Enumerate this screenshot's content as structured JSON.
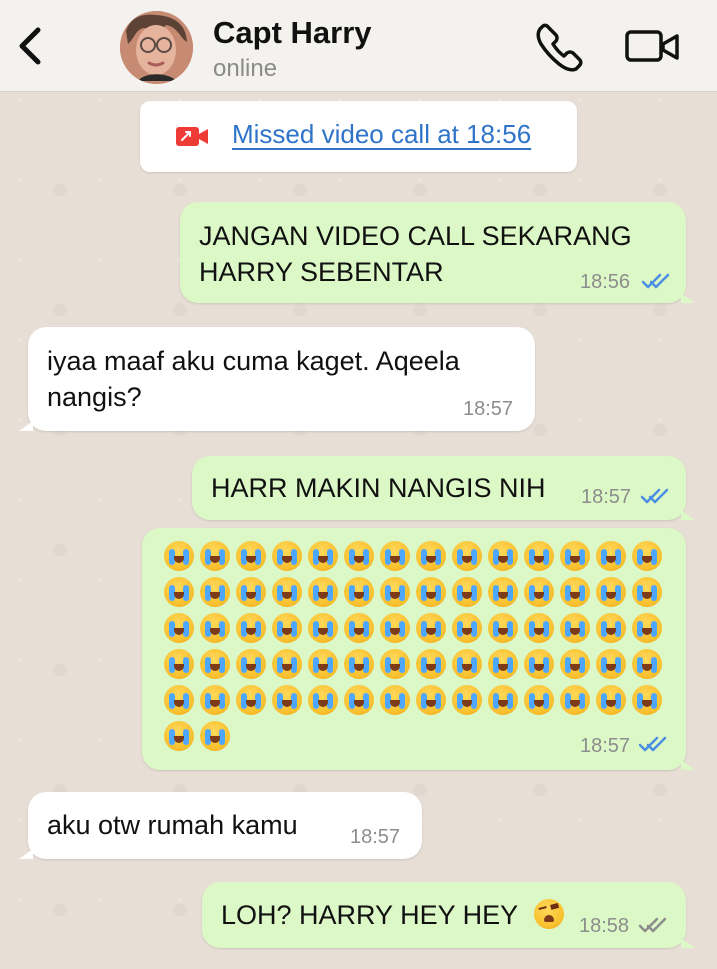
{
  "header": {
    "back_icon": "chevron-left-icon",
    "contact_name": "Capt Harry",
    "status": "online",
    "call_icon": "phone-icon",
    "video_icon": "video-camera-icon"
  },
  "missed_call": {
    "icon": "missed-video-call-icon",
    "text": "Missed video call at 18:56"
  },
  "messages": [
    {
      "direction": "outgoing",
      "text": "JANGAN VIDEO CALL SEKARANG\nHARRY SEBENTAR",
      "time": "18:56",
      "status": "read"
    },
    {
      "direction": "incoming",
      "text": "iyaa maaf aku cuma kaget. Aqeela\nnangis?",
      "time": "18:57"
    },
    {
      "direction": "outgoing",
      "text": "HARR MAKIN NANGIS NIH",
      "time": "18:57",
      "status": "read"
    },
    {
      "direction": "outgoing",
      "type": "emoji",
      "emoji": "😭",
      "emoji_name": "loudly-crying-face-emoji",
      "count": 72,
      "time": "18:57",
      "status": "read"
    },
    {
      "direction": "incoming",
      "text": "aku otw rumah kamu",
      "time": "18:57"
    },
    {
      "direction": "outgoing",
      "text": "LOH? HARRY HEY HEY",
      "trailing_emoji": "😫",
      "trailing_emoji_name": "weary-face-emoji",
      "time": "18:58",
      "status": "delivered"
    }
  ],
  "colors": {
    "outgoing_bubble": "#dcf8c6",
    "incoming_bubble": "#ffffff",
    "link_blue": "#2f74c9",
    "read_tick_blue": "#4a8fe2",
    "delivered_tick_gray": "#8d8d8d",
    "missed_call_red": "#ef3b36"
  }
}
